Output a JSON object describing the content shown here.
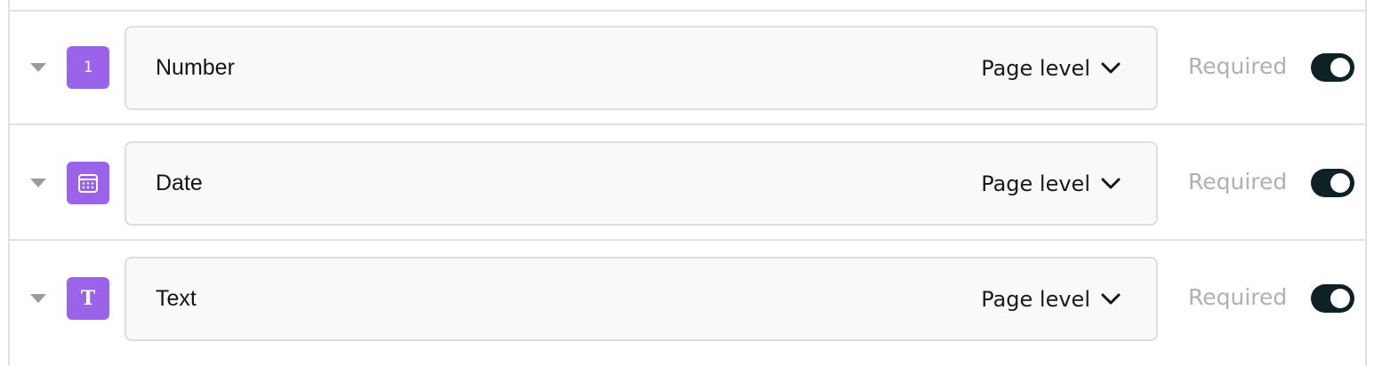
{
  "fields": [
    {
      "name": "Number",
      "level": "Page level",
      "required_label": "Required",
      "required": true,
      "icon": "number-one-icon",
      "icon_glyph": "1"
    },
    {
      "name": "Date",
      "level": "Page level",
      "required_label": "Required",
      "required": true,
      "icon": "calendar-icon",
      "icon_glyph": ""
    },
    {
      "name": "Text",
      "level": "Page level",
      "required_label": "Required",
      "required": true,
      "icon": "text-t-icon",
      "icon_glyph": "T"
    }
  ],
  "colors": {
    "icon_bg": "#9a63ea",
    "toggle_on": "#0e2226",
    "border": "#e2e2e2",
    "field_bg": "#f9f9f9",
    "muted_text": "#b0b0b0"
  }
}
